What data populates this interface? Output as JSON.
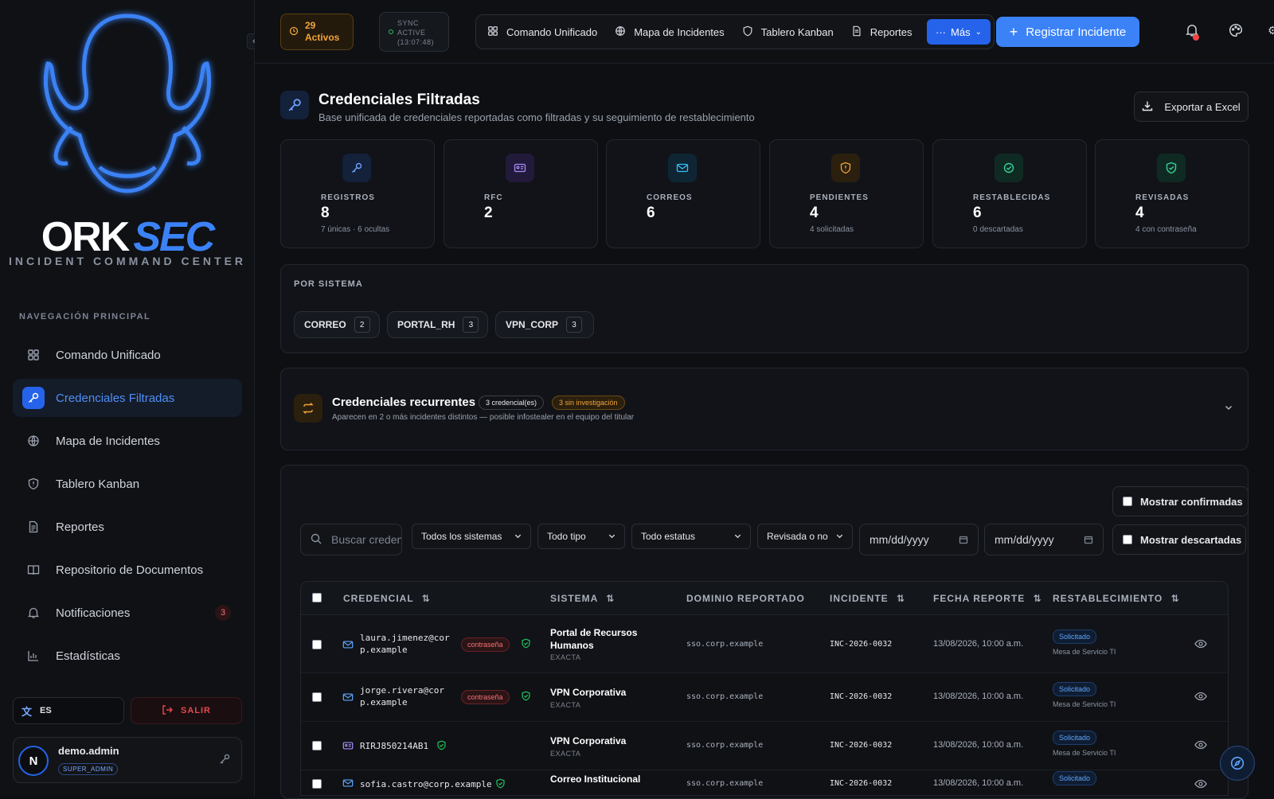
{
  "sidebar": {
    "brand_ork": "ORK",
    "brand_sec": "SEC",
    "tagline": "INCIDENT COMMAND CENTER",
    "nav_title": "NAVEGACIÓN PRINCIPAL",
    "items": [
      {
        "label": "Comando Unificado",
        "icon": "grid-icon"
      },
      {
        "label": "Credenciales Filtradas",
        "icon": "key-icon",
        "active": true
      },
      {
        "label": "Mapa de Incidentes",
        "icon": "globe-icon"
      },
      {
        "label": "Tablero Kanban",
        "icon": "shield-icon"
      },
      {
        "label": "Reportes",
        "icon": "file-icon"
      },
      {
        "label": "Repositorio de Documentos",
        "icon": "book-icon"
      },
      {
        "label": "Notificaciones",
        "icon": "bell-icon",
        "badge": "3"
      },
      {
        "label": "Estadísticas",
        "icon": "chart-icon"
      }
    ],
    "lang": "ES",
    "logout": "SALIR",
    "user": {
      "initial": "N",
      "name": "demo.admin",
      "role": "SUPER_ADMIN"
    }
  },
  "topbar": {
    "active_count": "29",
    "active_label": "Activos",
    "sync_line1": "SYNC",
    "sync_line2": "ACTIVE",
    "sync_line3": "(13:07:48)",
    "tabs": [
      "Comando Unificado",
      "Mapa de Incidentes",
      "Tablero Kanban",
      "Reportes"
    ],
    "more": "Más",
    "register": "Registrar Incidente"
  },
  "page": {
    "title": "Credenciales Filtradas",
    "subtitle": "Base unificada de credenciales reportadas como filtradas y su seguimiento de restablecimiento",
    "export": "Exportar a Excel"
  },
  "stats": [
    {
      "label": "REGISTROS",
      "value": "8",
      "sub": "7 únicas · 6 ocultas",
      "color": "#3b82f6"
    },
    {
      "label": "RFC",
      "value": "2",
      "sub": "",
      "color": "#8b5cf6"
    },
    {
      "label": "CORREOS",
      "value": "6",
      "sub": "",
      "color": "#0ea5e9"
    },
    {
      "label": "PENDIENTES",
      "value": "4",
      "sub": "4 solicitadas",
      "color": "#f59e0b"
    },
    {
      "label": "RESTABLECIDAS",
      "value": "6",
      "sub": "0 descartadas",
      "color": "#10b981"
    },
    {
      "label": "REVISADAS",
      "value": "4",
      "sub": "4 con contraseña",
      "color": "#10b981"
    }
  ],
  "por_sistema": {
    "title": "POR SISTEMA",
    "chips": [
      {
        "name": "CORREO",
        "count": "2"
      },
      {
        "name": "PORTAL_RH",
        "count": "3"
      },
      {
        "name": "VPN_CORP",
        "count": "3"
      }
    ]
  },
  "recurrentes": {
    "title": "Credenciales recurrentes",
    "badge1": "3 credencial(es)",
    "badge2": "3 sin investigación",
    "subtitle": "Aparecen en 2 o más incidentes distintos — posible infostealer en el equipo del titular"
  },
  "filters": {
    "show_confirmed": "Mostrar confirmadas",
    "show_discarded": "Mostrar descartadas",
    "search_placeholder": "Buscar credencial",
    "systems": "Todos los sistemas",
    "type": "Todo tipo",
    "status": "Todo estatus",
    "reviewed": "Revisada o no",
    "date_from": "mm/dd/yyyy",
    "date_to": "mm/dd/yyyy"
  },
  "table": {
    "headers": [
      "CREDENCIAL",
      "SISTEMA",
      "DOMINIO REPORTADO",
      "INCIDENTE",
      "FECHA REPORTE",
      "RESTABLECIMIENTO"
    ],
    "rows": [
      {
        "cred1": "laura.jimenez@cor",
        "cred2": "p.example",
        "pwd": "contraseña",
        "sys1": "Portal de Recursos",
        "sys2": "Humanos",
        "match": "EXACTA",
        "domain": "sso.corp.example",
        "incident": "INC-2026-0032",
        "date": "13/08/2026, 10:00 a.m.",
        "status": "Solicitado",
        "owner": "Mesa de Servicio TI"
      },
      {
        "cred1": "jorge.rivera@cor",
        "cred2": "p.example",
        "pwd": "contraseña",
        "sys1": "VPN Corporativa",
        "sys2": "",
        "match": "EXACTA",
        "domain": "sso.corp.example",
        "incident": "INC-2026-0032",
        "date": "13/08/2026, 10:00 a.m.",
        "status": "Solicitado",
        "owner": "Mesa de Servicio TI"
      },
      {
        "cred1": "RIRJ850214AB1",
        "cred2": "",
        "pwd": "",
        "sys1": "VPN Corporativa",
        "sys2": "",
        "match": "EXACTA",
        "domain": "sso.corp.example",
        "incident": "INC-2026-0032",
        "date": "13/08/2026, 10:00 a.m.",
        "status": "Solicitado",
        "owner": "Mesa de Servicio TI"
      },
      {
        "cred1": "sofia.castro@corp.example",
        "cred2": "",
        "pwd": "",
        "sys1": "Correo Institucional",
        "sys2": "",
        "match": "",
        "domain": "sso.corp.example",
        "incident": "INC-2026-0032",
        "date": "13/08/2026, 10:00 a.m.",
        "status": "Solicitado",
        "owner": ""
      }
    ]
  }
}
